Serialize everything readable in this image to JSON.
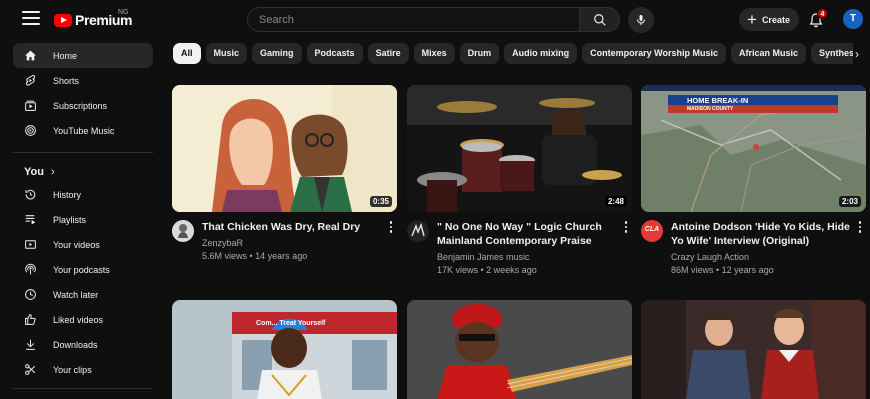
{
  "header": {
    "logo_text": "Premium",
    "country_code": "NG",
    "search_placeholder": "Search",
    "create_label": "Create",
    "notification_count": "4",
    "avatar_initial": "T"
  },
  "sidebar": {
    "main_items": [
      {
        "label": "Home",
        "icon": "home-icon"
      },
      {
        "label": "Shorts",
        "icon": "shorts-icon"
      },
      {
        "label": "Subscriptions",
        "icon": "subscriptions-icon"
      },
      {
        "label": "YouTube Music",
        "icon": "music-icon"
      }
    ],
    "you_label": "You",
    "you_items": [
      {
        "label": "History",
        "icon": "history-icon"
      },
      {
        "label": "Playlists",
        "icon": "playlists-icon"
      },
      {
        "label": "Your videos",
        "icon": "your-videos-icon"
      },
      {
        "label": "Your podcasts",
        "icon": "podcasts-icon"
      },
      {
        "label": "Watch later",
        "icon": "clock-icon"
      },
      {
        "label": "Liked videos",
        "icon": "thumbs-up-icon"
      },
      {
        "label": "Downloads",
        "icon": "download-icon"
      },
      {
        "label": "Your clips",
        "icon": "scissors-icon"
      }
    ]
  },
  "chips": [
    "All",
    "Music",
    "Gaming",
    "Podcasts",
    "Satire",
    "Mixes",
    "Drum",
    "Audio mixing",
    "Contemporary Worship Music",
    "African Music",
    "Synthesizer"
  ],
  "videos": [
    {
      "title": "That Chicken Was Dry, Real Dry",
      "channel": "ZenzybaR",
      "meta": "5.6M views • 14 years ago",
      "duration": "0:35"
    },
    {
      "title": "\" No One No Way \" Logic Church Mainland Contemporary Praise",
      "channel": "Benjamin James music",
      "meta": "17K views • 2 weeks ago",
      "duration": "2:48"
    },
    {
      "title": "Antoine Dodson 'Hide Yo Kids, Hide Yo Wife' Interview (Original)",
      "channel": "Crazy Laugh Action",
      "meta": "86M views • 12 years ago",
      "duration": "2:03",
      "avatar_text": "CLA",
      "thumb_banner": "HOME BREAK-IN",
      "thumb_subbanner": "MADISON COUNTY"
    }
  ],
  "row2_thumbs": [
    {
      "sign_text": "Com... Treat Yourself"
    },
    {},
    {}
  ],
  "colors": {
    "brand_red": "#ff0000",
    "background": "#0f0f0f",
    "chip_bg": "#272727",
    "avatar_blue": "#1565c0"
  }
}
